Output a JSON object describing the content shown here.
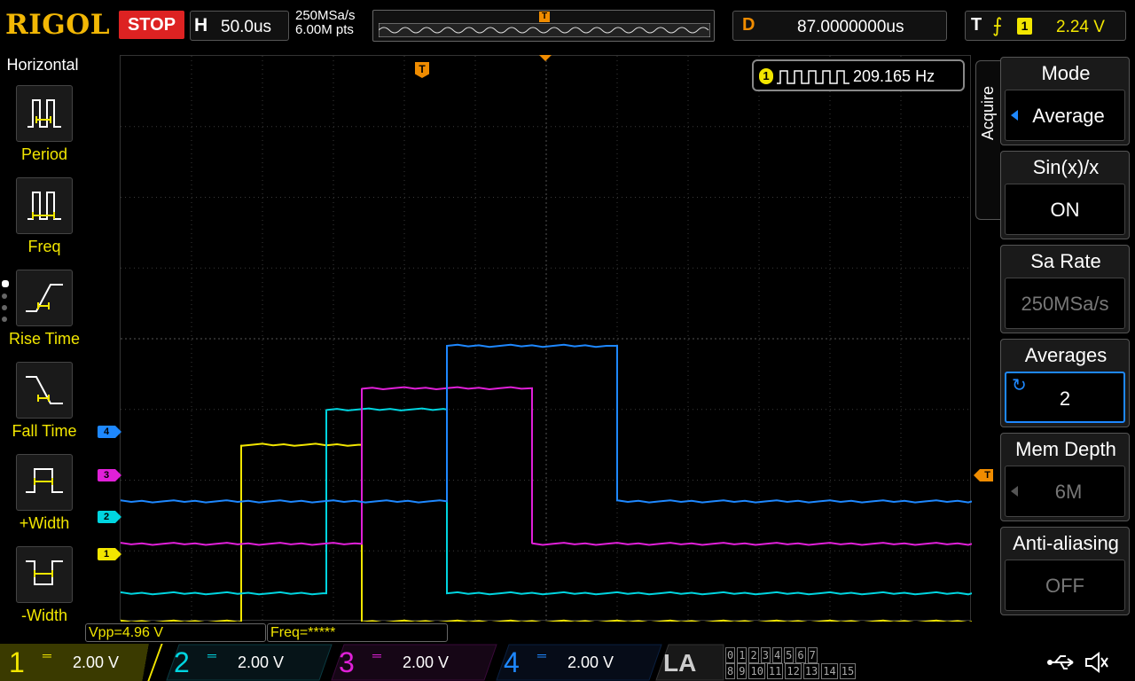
{
  "header": {
    "brand": "RIGOL",
    "run_state": "STOP",
    "horizontal_key": "H",
    "timebase": "50.0us",
    "sample_rate": "250MSa/s",
    "memory_points": "6.00M pts",
    "delay_key": "D",
    "delay": "87.0000000us",
    "trigger_key": "T",
    "trigger_source": "1",
    "trigger_level": "2.24 V"
  },
  "left_menu": {
    "title": "Horizontal",
    "items": [
      {
        "label": "Period"
      },
      {
        "label": "Freq"
      },
      {
        "label": "Rise Time"
      },
      {
        "label": "Fall Time"
      },
      {
        "label": "+Width"
      },
      {
        "label": "-Width"
      }
    ]
  },
  "freq_counter": {
    "source": "1",
    "value": "209.165 Hz"
  },
  "markers": {
    "trigger_pos": "T",
    "trigger_level": "T",
    "ch1": "1",
    "ch2": "2",
    "ch3": "3",
    "ch4": "4"
  },
  "right_menu": {
    "tab": "Acquire",
    "items": [
      {
        "title": "Mode",
        "value": "Average"
      },
      {
        "title": "Sin(x)/x",
        "value": "ON"
      },
      {
        "title": "Sa Rate",
        "value": "250MSa/s"
      },
      {
        "title": "Averages",
        "value": "2"
      },
      {
        "title": "Mem Depth",
        "value": "6M"
      },
      {
        "title": "Anti-aliasing",
        "value": "OFF"
      }
    ]
  },
  "measurements": {
    "vpp": "Vpp=4.96 V",
    "freq": "Freq=*****"
  },
  "channels": [
    {
      "num": "1",
      "scale": "2.00 V",
      "color": "#f2e600"
    },
    {
      "num": "2",
      "scale": "2.00 V",
      "color": "#00d5e0"
    },
    {
      "num": "3",
      "scale": "2.00 V",
      "color": "#e020d8"
    },
    {
      "num": "4",
      "scale": "2.00 V",
      "color": "#1e88ff"
    }
  ],
  "la": {
    "label": "LA",
    "row1": [
      "0",
      "1",
      "2",
      "3",
      "4",
      "5",
      "6",
      "7"
    ],
    "row2": [
      "8",
      "9",
      "10",
      "11",
      "12",
      "13",
      "14",
      "15"
    ]
  },
  "waveforms": [
    {
      "channel": "1",
      "color": "#f2e600",
      "low_div": -4.0,
      "high_div": -1.5,
      "rise_time_us": 85,
      "fall_time_us": 170
    },
    {
      "channel": "2",
      "color": "#00d5e0",
      "low_div": -3.6,
      "high_div": -1.0,
      "rise_time_us": 145,
      "fall_time_us": 230
    },
    {
      "channel": "3",
      "color": "#e020d8",
      "low_div": -2.9,
      "high_div": -0.7,
      "rise_time_us": 170,
      "fall_time_us": 290
    },
    {
      "channel": "4",
      "color": "#1e88ff",
      "low_div": -2.3,
      "high_div": -0.1,
      "rise_time_us": 230,
      "fall_time_us": 350
    }
  ]
}
